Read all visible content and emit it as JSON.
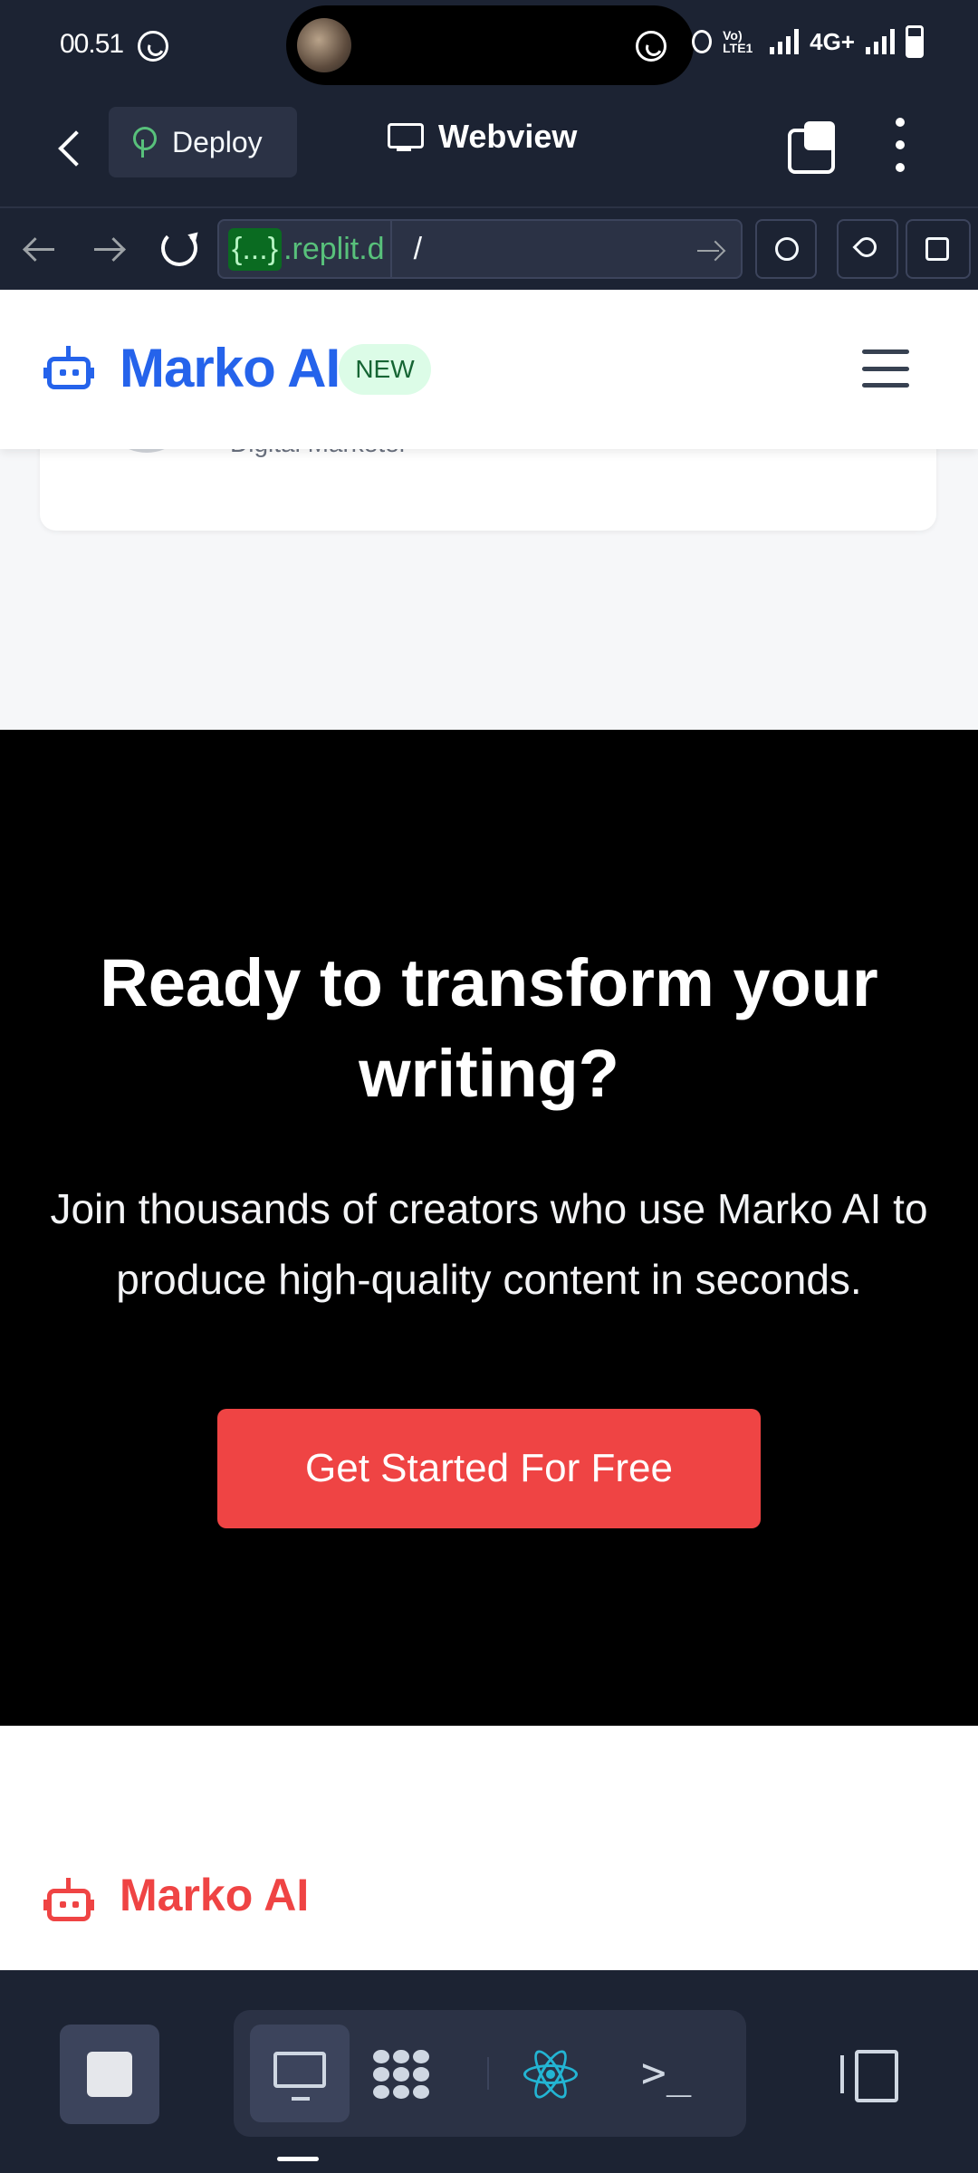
{
  "status_bar": {
    "time": "00.51",
    "network": "4G+",
    "volte": "Vo) LTE1"
  },
  "app_bar": {
    "deploy_label": "Deploy",
    "title": "Webview"
  },
  "browser": {
    "url_badge": "{...}",
    "url_host": ".replit.d",
    "url_path": "/"
  },
  "site": {
    "brand": "Marko AI",
    "badge": "NEW",
    "testimonial_role": "Digital Marketer",
    "cta": {
      "title": "Ready to transform your writing?",
      "subtitle": "Join thousands of creators who use Marko AI to produce high-quality content in seconds.",
      "button": "Get Started For Free"
    },
    "footer_brand": "Marko AI"
  },
  "bottom_toolbar": {
    "shell_glyph": ">_"
  },
  "colors": {
    "brand_blue": "#2563eb",
    "cta_red": "#ef4444",
    "replit_dark": "#1c2333"
  }
}
